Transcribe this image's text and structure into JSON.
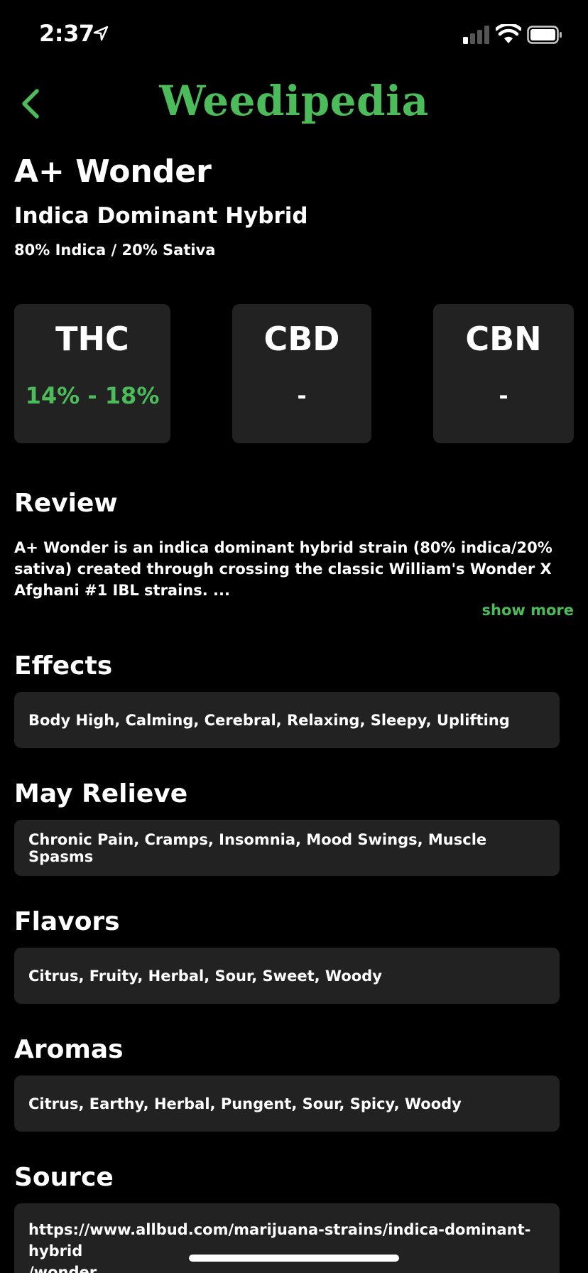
{
  "status": {
    "time": "2:37"
  },
  "nav": {
    "title": "Weedipedia"
  },
  "strain": {
    "name": "A+ Wonder",
    "type": "Indica Dominant Hybrid",
    "ratio": "80% Indica / 20% Sativa"
  },
  "stats": [
    {
      "label": "THC",
      "value": "14% - 18%"
    },
    {
      "label": "CBD",
      "value": "-"
    },
    {
      "label": "CBN",
      "value": "-"
    }
  ],
  "review": {
    "title": "Review",
    "text": "A+ Wonder is an indica dominant hybrid strain (80% indica/20% sativa) created through crossing the classic William's Wonder X Afghani #1 IBL strains. ...",
    "show_more": "show more"
  },
  "effects": {
    "title": "Effects",
    "value": "Body High, Calming, Cerebral, Relaxing, Sleepy, Uplifting"
  },
  "relieve": {
    "title": "May Relieve",
    "value": "Chronic Pain, Cramps, Insomnia, Mood Swings, Muscle Spasms"
  },
  "flavors": {
    "title": "Flavors",
    "value": "Citrus, Fruity, Herbal, Sour, Sweet, Woody"
  },
  "aromas": {
    "title": "Aromas",
    "value": "Citrus, Earthy, Herbal, Pungent, Sour, Spicy, Woody"
  },
  "source": {
    "title": "Source",
    "line1": "https://www.allbud.com/marijuana-strains/indica-dominant-hybrid",
    "line2": "/wonder"
  },
  "colors": {
    "accent": "#4CBB5A",
    "background": "#000000",
    "card": "#222222"
  }
}
